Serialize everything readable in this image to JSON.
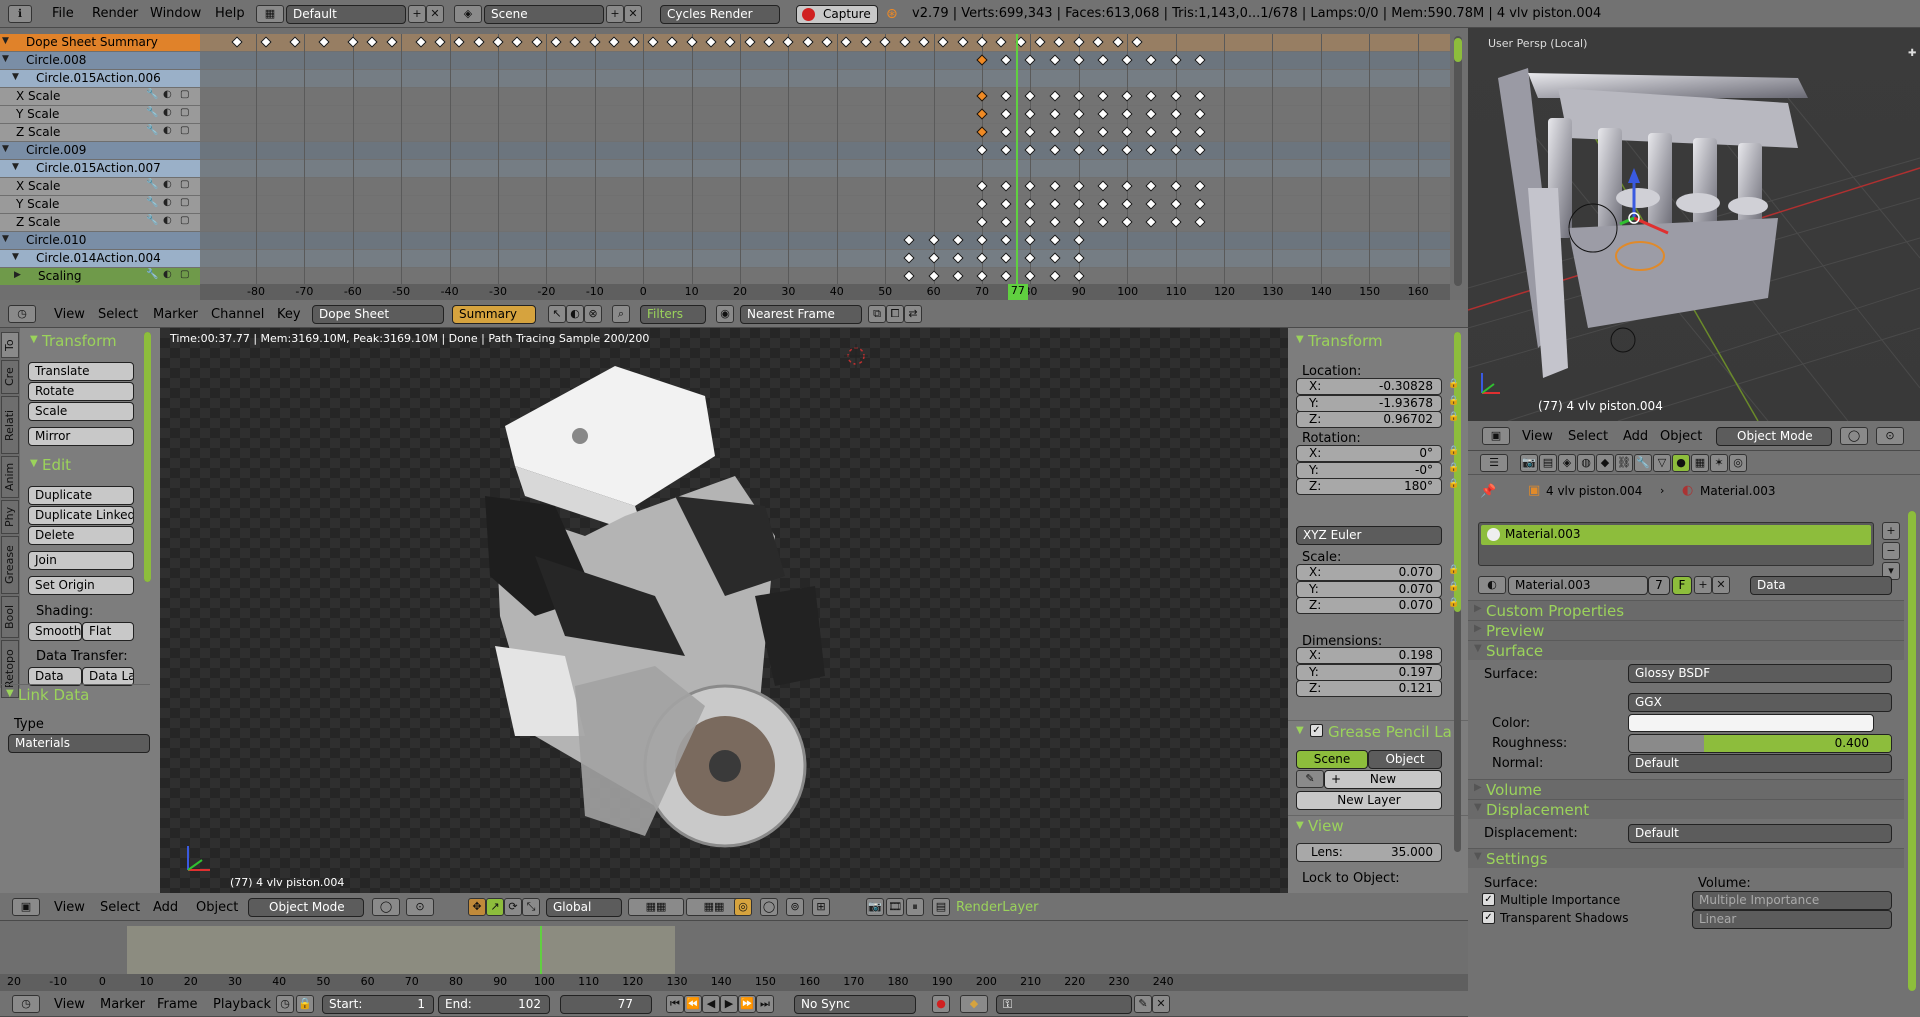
{
  "topbar": {
    "menus": [
      "File",
      "Render",
      "Window",
      "Help"
    ],
    "layout": "Default",
    "scene": "Scene",
    "engine": "Cycles Render",
    "capture": "Capture",
    "stats": "v2.79 | Verts:699,343 | Faces:613,068 | Tris:1,143,0...1/678 | Lamps:0/0 | Mem:590.78M | 4 vlv piston.004"
  },
  "dopesheet": {
    "channels": [
      {
        "label": "Dope Sheet Summary",
        "kind": "summary"
      },
      {
        "label": "Circle.008",
        "kind": "object"
      },
      {
        "label": "Circle.015Action.006",
        "kind": "action"
      },
      {
        "label": "X Scale",
        "kind": "fcurve"
      },
      {
        "label": "Y Scale",
        "kind": "fcurve"
      },
      {
        "label": "Z Scale",
        "kind": "fcurve"
      },
      {
        "label": "Circle.009",
        "kind": "object"
      },
      {
        "label": "Circle.015Action.007",
        "kind": "action"
      },
      {
        "label": "X Scale",
        "kind": "fcurve"
      },
      {
        "label": "Y Scale",
        "kind": "fcurve"
      },
      {
        "label": "Z Scale",
        "kind": "fcurve"
      },
      {
        "label": "Circle.010",
        "kind": "object"
      },
      {
        "label": "Circle.014Action.004",
        "kind": "action"
      },
      {
        "label": "Scaling",
        "kind": "group"
      }
    ],
    "ruler": [
      "-80",
      "-70",
      "-60",
      "-50",
      "-40",
      "-30",
      "-20",
      "-10",
      "0",
      "10",
      "20",
      "30",
      "40",
      "50",
      "60",
      "70",
      "80",
      "90",
      "100",
      "110",
      "120",
      "130",
      "140",
      "150",
      "160"
    ],
    "current_frame": "77",
    "header": {
      "menus": [
        "View",
        "Select",
        "Marker",
        "Channel",
        "Key"
      ],
      "mode": "Dope Sheet",
      "summary": "Summary",
      "filters": "Filters",
      "snap": "Nearest Frame"
    }
  },
  "viewport": {
    "label": "User Persp (Local)",
    "object_label": "(77) 4 vlv piston.004",
    "header": {
      "menus": [
        "View",
        "Select",
        "Add",
        "Object"
      ],
      "mode": "Object Mode"
    }
  },
  "render_view": {
    "status": "Time:00:37.77 | Mem:3169.10M, Peak:3169.10M | Done | Path Tracing Sample 200/200",
    "object_label": "(77) 4 vlv piston.004",
    "header": {
      "menus": [
        "View",
        "Select",
        "Add",
        "Object"
      ],
      "mode": "Object Mode",
      "orientation": "Global",
      "layer": "RenderLayer"
    }
  },
  "toolshelf": {
    "tabs": [
      "To",
      "Cre",
      "Relati",
      "Anim",
      "Phy",
      "Grease",
      "Bool",
      "Retopo"
    ],
    "transform": {
      "title": "Transform",
      "buttons": [
        "Translate",
        "Rotate",
        "Scale",
        "Mirror"
      ]
    },
    "edit": {
      "title": "Edit",
      "buttons": [
        "Duplicate",
        "Duplicate Linked",
        "Delete",
        "Join"
      ],
      "set_origin": "Set Origin",
      "shading_label": "Shading:",
      "smooth": "Smooth",
      "flat": "Flat",
      "data_transfer_label": "Data Transfer:",
      "data": "Data",
      "data_la": "Data La"
    },
    "link": {
      "title": "Link Data",
      "type_label": "Type",
      "type_value": "Materials"
    }
  },
  "npanel": {
    "title": "Transform",
    "location_label": "Location:",
    "location": [
      "-0.30828",
      "-1.93678",
      "0.96702"
    ],
    "rotation_label": "Rotation:",
    "rotation": [
      "0°",
      "-0°",
      "180°"
    ],
    "rot_mode": "XYZ Euler",
    "scale_label": "Scale:",
    "scale": [
      "0.070",
      "0.070",
      "0.070"
    ],
    "dimensions_label": "Dimensions:",
    "dimensions": [
      "0.198",
      "0.197",
      "0.121"
    ],
    "axes": [
      "X:",
      "Y:",
      "Z:"
    ],
    "grease_title": "Grease Pencil La",
    "gp_scene": "Scene",
    "gp_object": "Object",
    "gp_new": "New",
    "gp_new_layer": "New Layer",
    "view_title": "View",
    "lens_label": "Lens:",
    "lens": "35.000",
    "lock_label": "Lock to Object:"
  },
  "properties": {
    "breadcrumb_obj": "4 vlv piston.004",
    "breadcrumb_mat": "Material.003",
    "slot": "Material.003",
    "mat_name": "Material.003",
    "users": "7",
    "fake": "F",
    "link": "Data",
    "sections": {
      "custom": "Custom Properties",
      "preview": "Preview",
      "surface": "Surface",
      "volume": "Volume",
      "displacement": "Displacement",
      "settings": "Settings"
    },
    "surface_label": "Surface:",
    "surface_value": "Glossy BSDF",
    "dist": "GGX",
    "color_label": "Color:",
    "roughness_label": "Roughness:",
    "roughness": "0.400",
    "roughness_fraction": 0.4,
    "normal_label": "Normal:",
    "normal_value": "Default",
    "disp_label": "Displacement:",
    "disp_value": "Default",
    "settings_surface": "Surface:",
    "settings_volume": "Volume:",
    "mi": "Multiple Importance",
    "ts": "Transparent Shadows",
    "vol_mi": "Multiple Importance",
    "vol_linear": "Linear"
  },
  "timeline": {
    "ruler": [
      "20",
      "-10",
      "0",
      "10",
      "20",
      "30",
      "40",
      "50",
      "60",
      "70",
      "80",
      "90",
      "100",
      "110",
      "120",
      "130",
      "140",
      "150",
      "160",
      "170",
      "180",
      "190",
      "200",
      "210",
      "220",
      "230",
      "240"
    ],
    "menus": [
      "View",
      "Marker",
      "Frame",
      "Playback"
    ],
    "start_label": "Start:",
    "start": "1",
    "end_label": "End:",
    "end": "102",
    "current": "77",
    "sync": "No Sync"
  },
  "colors": {
    "accent_green": "#8dbd3c",
    "orange": "#f08a24",
    "header": "#727272",
    "panel": "#7a7a7a"
  }
}
